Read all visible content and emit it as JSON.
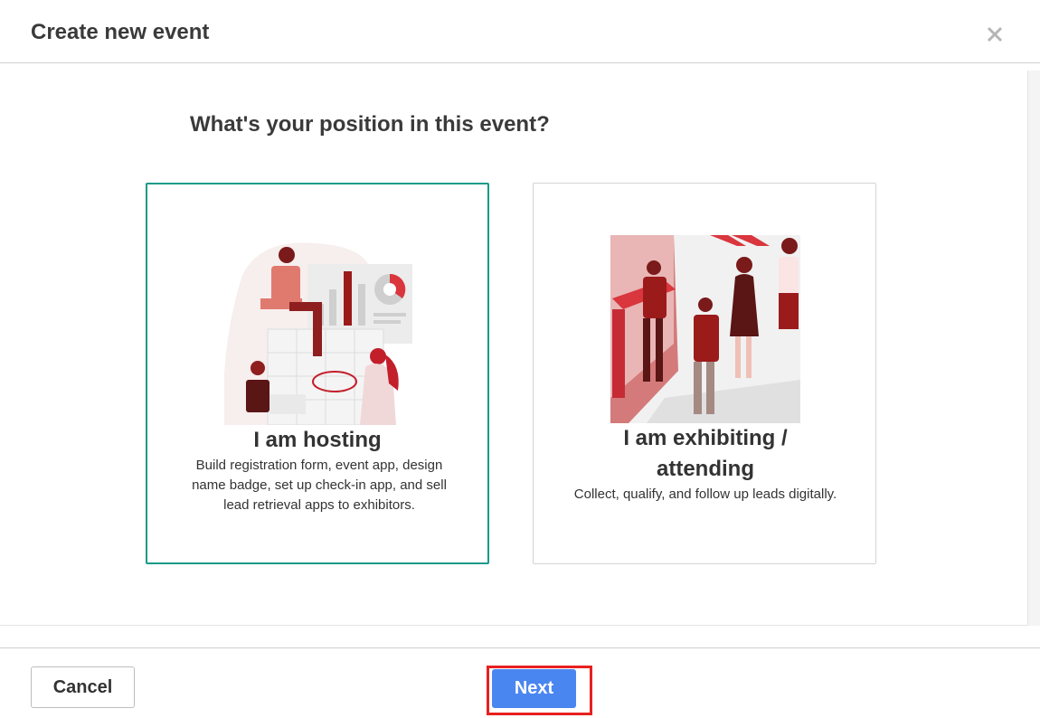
{
  "dialog": {
    "title": "Create new event",
    "close_icon": "close-icon"
  },
  "question": "What's your position in this event?",
  "options": [
    {
      "title": "I am hosting",
      "description": "Build registration form, event app, design name badge, set up check-in app, and sell lead retrieval apps to exhibitors.",
      "selected": true
    },
    {
      "title": "I am exhibiting / attending",
      "description": "Collect, qualify, and follow up leads digitally.",
      "selected": false
    }
  ],
  "footer": {
    "cancel_label": "Cancel",
    "next_label": "Next"
  },
  "colors": {
    "selected_border": "#1a9a8a",
    "primary_button": "#4a86f0",
    "highlight": "#e82020",
    "illustration_red": "#c0392b"
  }
}
